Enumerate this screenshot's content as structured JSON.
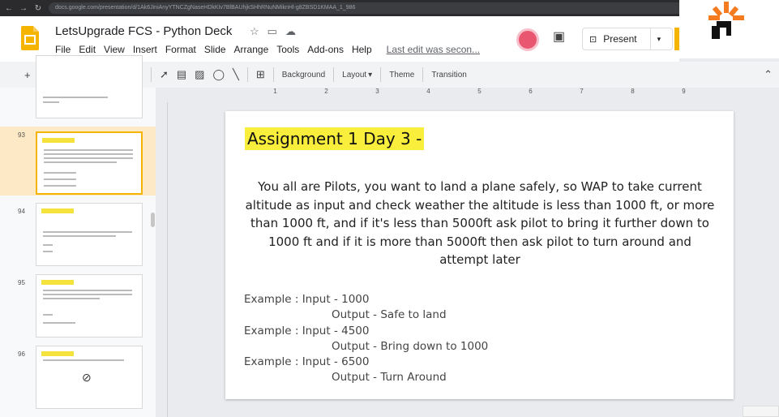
{
  "browser": {
    "url": "docs.google.com/presentation/d/1Ak6JiniAnyYTNCZgNaseHDkKIv7BlBAUhjkSHhRNuNMiknHl-g8ZBSD1KMAA_1_986"
  },
  "header": {
    "doc_title": "LetsUpgrade FCS - Python Deck",
    "menu": [
      "File",
      "Edit",
      "View",
      "Insert",
      "Format",
      "Slide",
      "Arrange",
      "Tools",
      "Add-ons",
      "Help"
    ],
    "last_edit": "Last edit was secon...",
    "present_label": "Present"
  },
  "toolbar": {
    "background_label": "Background",
    "layout_label": "Layout",
    "theme_label": "Theme",
    "transition_label": "Transition"
  },
  "ruler": [
    "1",
    "2",
    "3",
    "4",
    "5",
    "6",
    "7",
    "8",
    "9"
  ],
  "thumbnails": [
    {
      "num": ""
    },
    {
      "num": "93"
    },
    {
      "num": "94"
    },
    {
      "num": "95"
    },
    {
      "num": "96"
    }
  ],
  "slide": {
    "title": "Assignment 1 Day 3 -",
    "body": "You all are Pilots, you want to land a plane safely, so WAP to take current altitude as input and check weather the altitude is less than 1000 ft, or more than 1000 ft, and if it's less than 5000ft ask pilot to bring it further down to 1000 ft and if it is more than 5000ft then ask pilot to turn around and attempt later",
    "examples": [
      {
        "input": "Example : Input - 1000",
        "output": "Output - Safe to land"
      },
      {
        "input": "Example : Input - 4500",
        "output": "Output - Bring down to 1000"
      },
      {
        "input": "Example : Input - 6500",
        "output": "Output - Turn Around"
      }
    ]
  },
  "colors": {
    "highlight": "#f9ee3b",
    "selected_thumb_border": "#f4b400",
    "avatar": "#e8566f"
  }
}
